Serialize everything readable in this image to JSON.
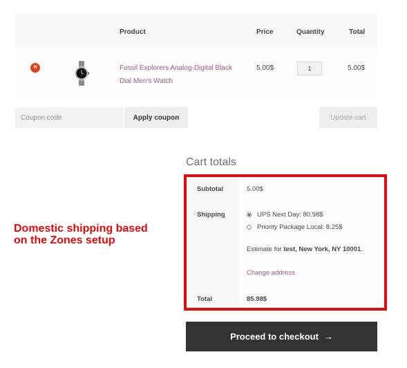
{
  "cart": {
    "headers": {
      "product": "Product",
      "price": "Price",
      "quantity": "Quantity",
      "total": "Total"
    },
    "item": {
      "remove_icon": "×",
      "product_line1": "Fossil Explorers Analog-Digital Black",
      "product_line2": "Dial Men's Watch",
      "price": "5.00$",
      "quantity": "1",
      "total": "5.00$"
    },
    "coupon_placeholder": "Coupon code",
    "apply_label": "Apply coupon",
    "update_label": "Update cart"
  },
  "totals": {
    "title": "Cart totals",
    "subtotal_label": "Subtotal",
    "subtotal_value": "5.00$",
    "shipping_label": "Shipping",
    "shipping_options": [
      "UPS Next Day: 80.98$",
      "Priority Package Local: 8.25$"
    ],
    "estimate_prefix": "Estimate for ",
    "estimate_location": "test, New York, NY 10001",
    "estimate_suffix": ".",
    "change_address": "Change address",
    "total_label": "Total",
    "total_value": "85.98$"
  },
  "annotation": {
    "line1": "Domestic shipping based",
    "line2": "on the Zones setup"
  },
  "checkout": {
    "label": "Proceed to checkout",
    "arrow": "→"
  },
  "colors": {
    "accent_purple": "#96588a",
    "annotation_red": "#e5090c",
    "button_dark": "#333333"
  }
}
